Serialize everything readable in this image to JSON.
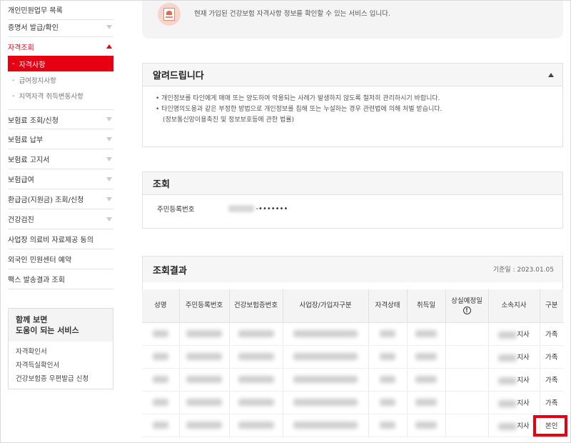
{
  "sidebar": {
    "items_top": [
      {
        "label": "개인민원업무 목록",
        "chev": false
      },
      {
        "label": "증명서 발급/확인",
        "chev": true
      },
      {
        "label": "자격조회",
        "chev": true,
        "open": true
      }
    ],
    "submenu": [
      {
        "label": "자격사항",
        "active": true
      },
      {
        "label": "급여정지사항",
        "active": false
      },
      {
        "label": "지역자격 취득변동사항",
        "active": false
      }
    ],
    "items_bottom": [
      {
        "label": "보험료 조회/신청",
        "chev": true
      },
      {
        "label": "보험료 납부",
        "chev": true
      },
      {
        "label": "보험료 고지서",
        "chev": true
      },
      {
        "label": "보험급여",
        "chev": true
      },
      {
        "label": "환급금(지원금) 조회/신청",
        "chev": true
      },
      {
        "label": "건강검진",
        "chev": true
      },
      {
        "label": "사업장 의료비 자료제공 동의",
        "chev": false
      },
      {
        "label": "외국인 민원센터 예약",
        "chev": false
      },
      {
        "label": "팩스 발송결과 조회",
        "chev": false
      }
    ],
    "service_box": {
      "title_line1": "함께 보면",
      "title_line2": "도움이 되는 서비스",
      "links": [
        "자격확인서",
        "자격득실확인서",
        "건강보험증 우편발급 신청"
      ]
    },
    "dash": "-"
  },
  "info": {
    "text": "현재 가입된 건강보험 자격사항 정보를 확인할 수 있는 서비스 입니다.",
    "icon": "id-card-icon"
  },
  "notice": {
    "title": "알려드립니다",
    "lines": [
      "• 개인정보를 타인에게 매매 또는 양도하여 악용되는 사례가 발생하지 않도록 철저히 관리하시기 바랍니다.",
      "• 타인명의도용과 같은 부정한 방법으로 개인정보를 침해 또는 누설하는 경우 관련법에 의해 처벌 받습니다.",
      "(정보통신망이용촉진 및 정보보호등에 관한 법률)"
    ]
  },
  "search": {
    "title": "조회",
    "field_label": "주민등록번호",
    "mask": "-•••••••"
  },
  "result": {
    "title": "조회결과",
    "ref_date": "기준일 : 2023.01.05",
    "headers": [
      "성명",
      "주민등록번호",
      "건강보험증번호",
      "사업장/가입자구분",
      "자격상태",
      "취득일",
      "상실예정일",
      "소속지사",
      "구분"
    ],
    "info_mark": "!",
    "rows": [
      {
        "branch_suffix": "지사",
        "type": "가족"
      },
      {
        "branch_suffix": "지사",
        "type": "가족"
      },
      {
        "branch_suffix": "지사",
        "type": "가족"
      },
      {
        "branch_suffix": "지사",
        "type": "가족"
      },
      {
        "branch_suffix": "지사",
        "type": "본인"
      }
    ]
  },
  "colors": {
    "accent": "#e60012",
    "panel_bg": "#f6f6f6"
  }
}
